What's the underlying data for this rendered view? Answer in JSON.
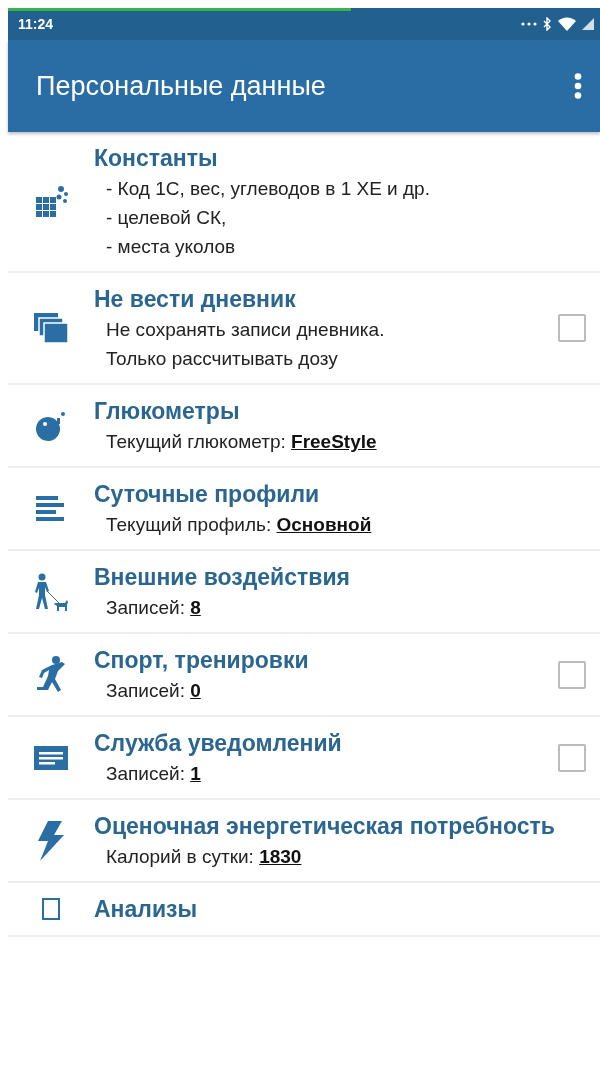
{
  "status_bar": {
    "time": "11:24",
    "loading_bar": {
      "level": 0.58
    }
  },
  "app_bar": {
    "title": "Персональные данные"
  },
  "items": [
    {
      "kind": "plain",
      "title": "Константы",
      "lines": [
        "- Код 1С, вес, углеводов в 1 ХЕ и др.",
        "- целевой СК,",
        "- места уколов"
      ]
    },
    {
      "kind": "checkbox",
      "title": "Не вести дневник",
      "lines": [
        "Не сохранять записи дневника.",
        "Только рассчитывать дозу"
      ],
      "checked": false
    },
    {
      "kind": "plain",
      "title": "Глюкометры",
      "label": "Текущий глюкометр:",
      "value": "FreeStyle"
    },
    {
      "kind": "plain",
      "title": "Суточные профили",
      "label": "Текущий профиль:",
      "value": "Основной"
    },
    {
      "kind": "plain",
      "title": "Внешние воздействия",
      "label": "Записей:",
      "value": "8"
    },
    {
      "kind": "checkbox",
      "title": "Спорт, тренировки",
      "label": "Записей:",
      "value": "0",
      "checked": false
    },
    {
      "kind": "checkbox",
      "title": "Служба уведомлений",
      "label": "Записей:",
      "value": "1",
      "checked": false
    },
    {
      "kind": "plain",
      "title": "Оценочная энергетическая потребность",
      "label": "Калорий в сутки:",
      "value": "1830"
    },
    {
      "kind": "plain",
      "title": "Анализы"
    }
  ]
}
